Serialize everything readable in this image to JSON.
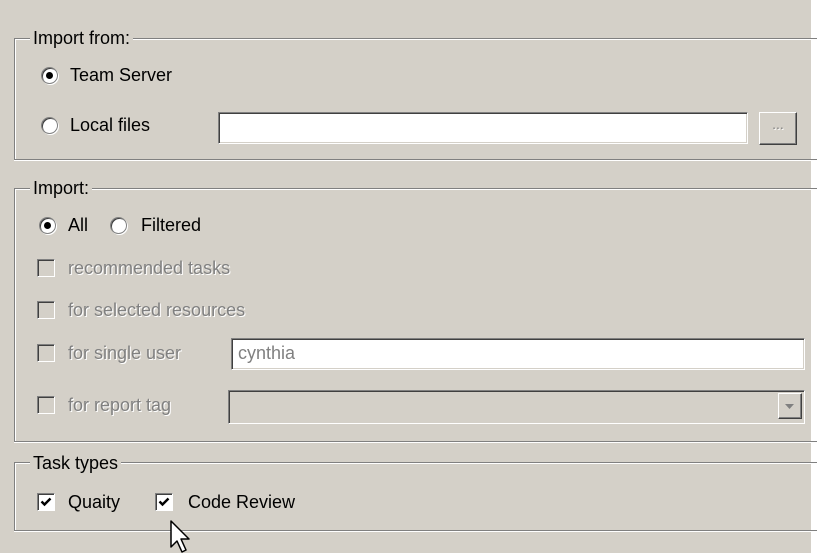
{
  "import_from": {
    "legend": "Import from:",
    "team_server_label": "Team Server",
    "local_files_label": "Local files",
    "local_files_path": "",
    "browse_label": "..."
  },
  "import": {
    "legend": "Import:",
    "all_label": "All",
    "filtered_label": "Filtered",
    "recommended_label": "recommended tasks",
    "selected_resources_label": "for selected resources",
    "single_user_label": "for single user",
    "single_user_value": "cynthia",
    "report_tag_label": "for report tag",
    "report_tag_value": ""
  },
  "task_types": {
    "legend": "Task types",
    "quality_label": "Quaity",
    "code_review_label": "Code Review"
  },
  "state": {
    "import_from_selected": "Team Server",
    "import_selected": "All",
    "quality_checked": true,
    "code_review_checked": true
  },
  "icons": {
    "cursor": "mouse-pointer-icon",
    "combo_arrow": "chevron-down-icon"
  },
  "colors": {
    "panel_bg": "#d4d0c8",
    "disabled_text": "#808080"
  }
}
